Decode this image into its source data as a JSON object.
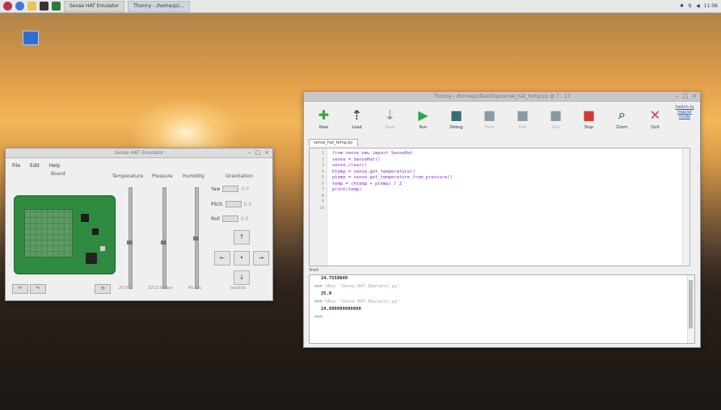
{
  "taskbar": {
    "window_buttons": [
      "Sense HAT Emulator",
      "Thonny - /home/pi/..."
    ],
    "clock": "11:06"
  },
  "sense_hat": {
    "title": "Sense HAT Emulator",
    "menu": [
      "File",
      "Edit",
      "Help"
    ],
    "column_headers": [
      "Board",
      "Temperature",
      "Pressure",
      "Humidity",
      "Orientation"
    ],
    "orientation_rows": [
      {
        "label": "Yaw",
        "value": "0.0"
      },
      {
        "label": "Pitch",
        "value": "0.0"
      },
      {
        "label": "Roll",
        "value": "0.0"
      }
    ],
    "slider_levels": {
      "temperature": 0.45,
      "pressure": 0.45,
      "humidity": 0.5
    },
    "bottom_labels": [
      "25.0°C",
      "1013.0mbar",
      "45.0%",
      "Joystick"
    ]
  },
  "thonny": {
    "title": "Thonny - /home/pi/Desktop/sense_hat_temp.py @ 7 : 17",
    "toolbar": [
      {
        "label": "New",
        "icon": "new-file-icon",
        "color": "#3aa83a",
        "glyph": "✚",
        "disabled": false
      },
      {
        "label": "Load",
        "icon": "load-icon",
        "color": "#444444",
        "glyph": "⇡",
        "disabled": false
      },
      {
        "label": "Save",
        "icon": "save-icon",
        "color": "#9a9a9a",
        "glyph": "⇣",
        "disabled": true
      },
      {
        "label": "Run",
        "icon": "run-icon",
        "color": "#2aa84a",
        "glyph": "▶",
        "disabled": false
      },
      {
        "label": "Debug",
        "icon": "debug-icon",
        "color": "#3a6a7a",
        "glyph": "■",
        "disabled": false
      },
      {
        "label": "Over",
        "icon": "step-over-icon",
        "color": "#8a9aa4",
        "glyph": "■",
        "disabled": true
      },
      {
        "label": "Into",
        "icon": "step-into-icon",
        "color": "#8a9aa4",
        "glyph": "■",
        "disabled": true
      },
      {
        "label": "Out",
        "icon": "step-out-icon",
        "color": "#8a9aa4",
        "glyph": "■",
        "disabled": true
      },
      {
        "label": "Stop",
        "icon": "stop-icon",
        "color": "#d23a3a",
        "glyph": "■",
        "disabled": false
      },
      {
        "label": "Zoom",
        "icon": "zoom-icon",
        "color": "#3a8a5a",
        "glyph": "⌕",
        "disabled": false
      },
      {
        "label": "Quit",
        "icon": "quit-icon",
        "color": "#d23a3a",
        "glyph": "✕",
        "disabled": false
      }
    ],
    "corner_link": "Switch to regular mode",
    "tab_label": "sense_hat_temp.py",
    "editor_lines": [
      "from sense_emu import SenseHat",
      "sense = SenseHat()",
      "sense.clear()",
      "htemp = sense.get_temperature()",
      "ptemp = sense.get_temperature_from_pressure()",
      "temp = (htemp + ptemp) / 2",
      "print(temp)"
    ],
    "line_numbers": [
      "1",
      "2",
      "3",
      "4",
      "5",
      "6",
      "7",
      "8",
      "9",
      "10"
    ],
    "shell_label": "Shell",
    "shell_lines": [
      {
        "kind": "out",
        "text": "24.7558049"
      },
      {
        "kind": "cmd",
        "prompt": ">>>",
        "text": "%Run 'Sense HAT Emulator.py'"
      },
      {
        "kind": "out",
        "text": "25.0"
      },
      {
        "kind": "cmd",
        "prompt": ">>>",
        "text": "%Run 'Sense HAT Emulator.py'"
      },
      {
        "kind": "out",
        "text": "24.999999999999"
      },
      {
        "kind": "cmd",
        "prompt": ">>>",
        "text": ""
      }
    ]
  }
}
